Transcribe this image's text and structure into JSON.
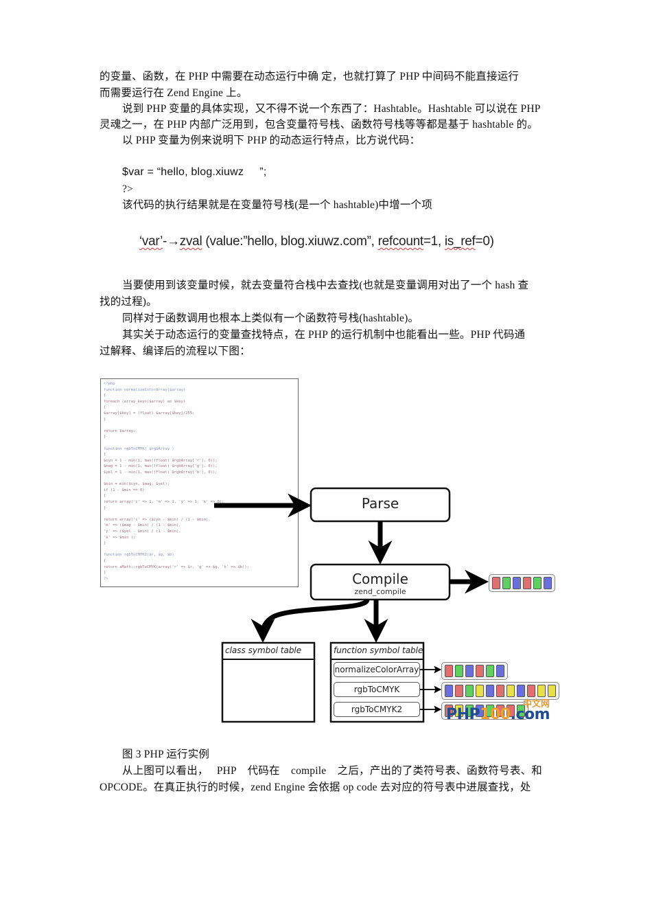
{
  "paragraphs_top": [
    {
      "text": "的变量、函数，在  PHP  中需要在动态运行中确  定，也就打算了  PHP  中间码不能直接运行",
      "indent": false
    },
    {
      "text": "而需要运行在  Zend Engine 上。",
      "indent": false
    },
    {
      "text": "说到  PHP 变量的具体实现，又不得不说一个东西了：Hashtable。Hashtable 可以说在  PHP",
      "indent": true
    },
    {
      "text": "灵魂之一，在  PHP  内部广泛用到，包含变量符号栈、函数符号栈等等都是基于  hashtable  的。",
      "indent": false
    },
    {
      "text": "以  PHP 变量为例来说明下  PHP 的动态运行特点，比方说代码：",
      "indent": true
    }
  ],
  "code_sample": {
    "line1": "$var = “hello, blog.xiuwz     ”;",
    "line2": "?>"
  },
  "result_sentence": "该代码的执行结果就是在变量符号栈(是一个   hashtable)中增一个项",
  "zval_line": {
    "part1": "‘var’",
    "arrow": "-→",
    "part2": "zval",
    "part3": " (value:”hello, blog.xiuwz.com”, ",
    "part4": "refcount",
    "part5": "=1, ",
    "part6": "is_ref",
    "part7": "=0)"
  },
  "paragraphs_mid": [
    {
      "text": "当要使用到该变量时候，就去变量符合栈中去查找(也就是变量调用对出了一个  hash 查",
      "indent": true
    },
    {
      "text": "找的过程)。",
      "indent": false
    },
    {
      "text": "同样对于函数调用也根本上类似有一个函数符号栈(hashtable)。",
      "indent": true
    },
    {
      "text": "其实关于动态运行的变量查找特点，在  PHP  的运行机制中也能看出一些。PHP 代码通",
      "indent": true
    },
    {
      "text": "过解释、编译后的流程以下图：",
      "indent": false
    }
  ],
  "figure": {
    "code_lines": [
      "<?php",
      "function normalizeColorArray($array)",
      "{",
      "    foreach (array_keys($array) as $key)",
      "    {",
      "        $array[$key] = (float) $array[$key]/255;",
      "    }",
      "",
      "    return $array;",
      "}",
      "",
      "function rgbToCMYK( $rgbArray )",
      "{",
      "    $cyn = 1 - min(1, max((float) $rgbArray['r'], 0));",
      "    $mag = 1 - min(1, max((float) $rgbArray['g'], 0));",
      "    $yel = 1 - min(1, max((float) $rgbArray['b'], 0));",
      "",
      "    $min = min($cyn, $mag, $yel);",
      "    if (1 - $min == 0)",
      "    {",
      "        return array('c' => 1, 'm' => 1, 'y' => 1, 'k' => 0);",
      "    }",
      "",
      "    return array('c' => ($cyn - $min) / (1 - $min),",
      "                 'm' => ($mag - $min) / (1 - $min),",
      "                 'y' => ($yel - $min) / (1 - $min),",
      "                 'k' => $min );",
      "}",
      "",
      "function rgbToCMYK2($r, $g, $b)",
      "{",
      "    return aMath::rgbToCMYK(array('r' => $r, 'g' => $g, 'b' => $b));",
      "}",
      "?>"
    ],
    "parse_label": "Parse",
    "compile_label": "Compile",
    "compile_sub": "zend_compile",
    "class_table_title": "class symbol table",
    "function_table_title": "function symbol table",
    "functions": [
      "normalizeColorArray",
      "rgbToCMYK",
      "rgbToCMYK2"
    ],
    "opcode_colors": {
      "r": "#e0706f",
      "g": "#5fcf5f",
      "b": "#6a6fdc",
      "y": "#e8e04a"
    },
    "opcodes_main": [
      "r",
      "g",
      "b",
      "r",
      "g",
      "b"
    ],
    "opcodes_functions": [
      [
        "r",
        "g",
        "b",
        "r",
        "g",
        "b"
      ],
      [
        "b",
        "r",
        "g",
        "y",
        "b",
        "r",
        "y",
        "b",
        "r",
        "y",
        "y"
      ],
      [
        "r",
        "y",
        "g",
        "b",
        "g",
        "r",
        "r",
        "g"
      ]
    ],
    "watermark": {
      "php": "PHP",
      "num": "100",
      "dotcom": ".com",
      "cn": "中文网"
    }
  },
  "caption": "图 3 PHP 运行实例",
  "paragraphs_bottom": [
    {
      "text": "从上图可以看出，   PHP    代码在    compile    之后，产出的了类符号表、函数符号表、和",
      "indent": true
    },
    {
      "text": "OPCODE。在真正执行的时候，zend Engine 会依据  op code 去对应的符号表中进展查找，处",
      "indent": false
    }
  ]
}
